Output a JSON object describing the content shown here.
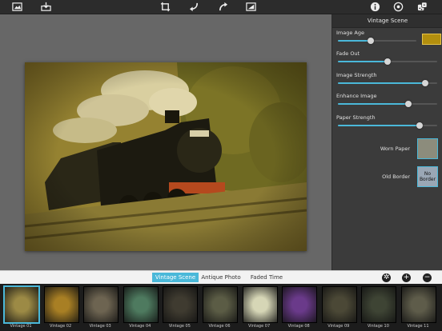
{
  "toolbar": {
    "left_icons": [
      "photo-library-icon",
      "save-download-icon"
    ],
    "center_icons": [
      "crop-icon",
      "undo-icon",
      "redo-icon",
      "compare-icon"
    ],
    "right_icons": [
      "info-icon",
      "settings-icon",
      "random-dice-icon"
    ]
  },
  "panel": {
    "title": "Vintage Scene",
    "sliders": [
      {
        "label": "Image Age",
        "value": 0.42,
        "swatch": "#b38f0e"
      },
      {
        "label": "Fade Out",
        "value": 0.5
      },
      {
        "label": "Image Strength",
        "value": 0.88
      },
      {
        "label": "Enhance Image",
        "value": 0.71
      },
      {
        "label": "Paper Strength",
        "value": 0.82
      }
    ],
    "options": [
      {
        "label": "Worn Paper",
        "value": ""
      },
      {
        "label": "Old Border",
        "value": "No Border"
      }
    ]
  },
  "tabs": [
    {
      "label": "Vintage Scene",
      "active": true
    },
    {
      "label": "Antique Photo",
      "active": false
    },
    {
      "label": "Faded Time",
      "active": false
    }
  ],
  "tab_controls": [
    "settings-icon",
    "add-icon",
    "remove-icon"
  ],
  "presets": [
    {
      "label": "Vintage 01",
      "color": "#9c8a45",
      "selected": true
    },
    {
      "label": "Vintage 02",
      "color": "#a87f24"
    },
    {
      "label": "Vintage 03",
      "color": "#6d6451"
    },
    {
      "label": "Vintage 04",
      "color": "#4e7a5f"
    },
    {
      "label": "Vintage 05",
      "color": "#3f3b30"
    },
    {
      "label": "Vintage 06",
      "color": "#5b5c45"
    },
    {
      "label": "Vintage 07",
      "color": "#d6d6b6"
    },
    {
      "label": "Vintage 08",
      "color": "#6a3a8a"
    },
    {
      "label": "Vintage 09",
      "color": "#4b4836"
    },
    {
      "label": "Vintage 10",
      "color": "#3e4434"
    },
    {
      "label": "Vintage 11",
      "color": "#5e5c4a"
    }
  ],
  "colors": {
    "accent": "#4ab8d9"
  }
}
